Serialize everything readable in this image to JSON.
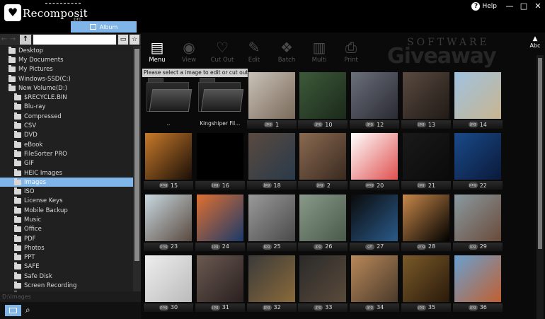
{
  "app": {
    "name": "Recomposit",
    "edition": "pro",
    "album_tab": "Album"
  },
  "window": {
    "help": "Help",
    "minimize": "—",
    "maximize": "□",
    "close": "✕"
  },
  "toolbar": {
    "buttons": [
      {
        "label": "Menu",
        "icon": "menu-icon",
        "active": true
      },
      {
        "label": "View",
        "icon": "eye-icon",
        "active": false
      },
      {
        "label": "Cut Out",
        "icon": "heart-cut-icon",
        "active": false
      },
      {
        "label": "Edit",
        "icon": "wand-icon",
        "active": false
      },
      {
        "label": "Batch",
        "icon": "batch-icon",
        "active": false
      },
      {
        "label": "Multi",
        "icon": "multi-icon",
        "active": false
      },
      {
        "label": "Print",
        "icon": "printer-icon",
        "active": false
      }
    ],
    "sort_label": "Abc"
  },
  "watermark": {
    "line1": "SOFTWARE",
    "line2": "Giveaway"
  },
  "tooltip": "Please select a image to edit or cut out.",
  "tree": {
    "nodes": [
      {
        "label": "Desktop",
        "level": 0,
        "selected": false
      },
      {
        "label": "My Documents",
        "level": 0,
        "selected": false
      },
      {
        "label": "My Pictures",
        "level": 0,
        "selected": false
      },
      {
        "label": "Windows-SSD(C:)",
        "level": 0,
        "selected": false
      },
      {
        "label": "New Volume(D:)",
        "level": 0,
        "selected": false
      },
      {
        "label": "$RECYCLE.BIN",
        "level": 1,
        "selected": false
      },
      {
        "label": "Blu-ray",
        "level": 1,
        "selected": false
      },
      {
        "label": "Compressed",
        "level": 1,
        "selected": false
      },
      {
        "label": "CSV",
        "level": 1,
        "selected": false
      },
      {
        "label": "DVD",
        "level": 1,
        "selected": false
      },
      {
        "label": "eBook",
        "level": 1,
        "selected": false
      },
      {
        "label": "FileSorter PRO",
        "level": 1,
        "selected": false
      },
      {
        "label": "GIF",
        "level": 1,
        "selected": false
      },
      {
        "label": "HEIC Images",
        "level": 1,
        "selected": false
      },
      {
        "label": "Images",
        "level": 1,
        "selected": true
      },
      {
        "label": "ISO",
        "level": 1,
        "selected": false
      },
      {
        "label": "License Keys",
        "level": 1,
        "selected": false
      },
      {
        "label": "Mobile Backup",
        "level": 1,
        "selected": false
      },
      {
        "label": "Music",
        "level": 1,
        "selected": false
      },
      {
        "label": "Office",
        "level": 1,
        "selected": false
      },
      {
        "label": "PDF",
        "level": 1,
        "selected": false
      },
      {
        "label": "Photos",
        "level": 1,
        "selected": false
      },
      {
        "label": "PPT",
        "level": 1,
        "selected": false
      },
      {
        "label": "SAFE",
        "level": 1,
        "selected": false
      },
      {
        "label": "Safe Disk",
        "level": 1,
        "selected": false
      },
      {
        "label": "Screen Recording",
        "level": 1,
        "selected": false
      },
      {
        "label": "Software Files",
        "level": 1,
        "selected": false
      }
    ],
    "current_path": "D:\\Images"
  },
  "grid": {
    "items": [
      {
        "kind": "folder",
        "label": ".."
      },
      {
        "kind": "folder",
        "label": "Kingshiper Fil..."
      },
      {
        "kind": "image",
        "badge": "jpg",
        "label": "1",
        "colors": [
          "#c9c2b8",
          "#7a6a5a"
        ]
      },
      {
        "kind": "image",
        "badge": "jpg",
        "label": "10",
        "colors": [
          "#3d5a3a",
          "#1b2a1a"
        ]
      },
      {
        "kind": "image",
        "badge": "jpg",
        "label": "12",
        "colors": [
          "#6a6f7a",
          "#2a2a33"
        ]
      },
      {
        "kind": "image",
        "badge": "jpg",
        "label": "13",
        "colors": [
          "#5a4a40",
          "#201a16"
        ]
      },
      {
        "kind": "image",
        "badge": "jpg",
        "label": "14",
        "colors": [
          "#9fc3e0",
          "#c8b490"
        ]
      },
      {
        "kind": "image",
        "badge": "png",
        "label": "15",
        "colors": [
          "#c87a2a",
          "#1a0f08"
        ]
      },
      {
        "kind": "image",
        "badge": "jpg",
        "label": "16",
        "colors": [
          "#000000",
          "#000000"
        ]
      },
      {
        "kind": "image",
        "badge": "jpg",
        "label": "18",
        "colors": [
          "#5a4a40",
          "#2a3a4a"
        ]
      },
      {
        "kind": "image",
        "badge": "jpg",
        "label": "2",
        "colors": [
          "#8a6a50",
          "#3a2a20"
        ]
      },
      {
        "kind": "image",
        "badge": "png",
        "label": "20",
        "colors": [
          "#ffffff",
          "#e05050"
        ]
      },
      {
        "kind": "image",
        "badge": "jpg",
        "label": "21",
        "colors": [
          "#1a1a1a",
          "#0a0a0a"
        ]
      },
      {
        "kind": "image",
        "badge": "png",
        "label": "22",
        "colors": [
          "#1a4a8a",
          "#0a1a3a"
        ]
      },
      {
        "kind": "image",
        "badge": "png",
        "label": "23",
        "colors": [
          "#c8d8e0",
          "#5a4a40"
        ]
      },
      {
        "kind": "image",
        "badge": "jpg",
        "label": "24",
        "colors": [
          "#e07030",
          "#1a3a6a"
        ]
      },
      {
        "kind": "image",
        "badge": "jpg",
        "label": "25",
        "colors": [
          "#9a9a9a",
          "#4a4a4a"
        ]
      },
      {
        "kind": "image",
        "badge": "jpg",
        "label": "26",
        "colors": [
          "#8a9a8a",
          "#4a5a4a"
        ]
      },
      {
        "kind": "image",
        "badge": "gif",
        "label": "27",
        "colors": [
          "#0a0a0a",
          "#2a5a8a"
        ]
      },
      {
        "kind": "image",
        "badge": "png",
        "label": "28",
        "colors": [
          "#c8884a",
          "#000000"
        ]
      },
      {
        "kind": "image",
        "badge": "jpg",
        "label": "29",
        "colors": [
          "#8a9aa0",
          "#6a4a3a"
        ]
      },
      {
        "kind": "image",
        "badge": "png",
        "label": "30",
        "colors": [
          "#eeeeee",
          "#bbbbbb"
        ]
      },
      {
        "kind": "image",
        "badge": "jpg",
        "label": "31",
        "colors": [
          "#6a5a50",
          "#2a2020"
        ]
      },
      {
        "kind": "image",
        "badge": "jpg",
        "label": "32",
        "colors": [
          "#3a3a3a",
          "#8a6a3a"
        ]
      },
      {
        "kind": "image",
        "badge": "jpg",
        "label": "33",
        "colors": [
          "#2a2a2a",
          "#5a4a3a"
        ]
      },
      {
        "kind": "image",
        "badge": "jpg",
        "label": "34",
        "colors": [
          "#b8885a",
          "#4a3a2a"
        ]
      },
      {
        "kind": "image",
        "badge": "jpg",
        "label": "35",
        "colors": [
          "#7a5a2a",
          "#2a1a0a"
        ]
      },
      {
        "kind": "image",
        "badge": "jpg",
        "label": "36",
        "colors": [
          "#6aa0d0",
          "#c06030"
        ]
      }
    ]
  }
}
